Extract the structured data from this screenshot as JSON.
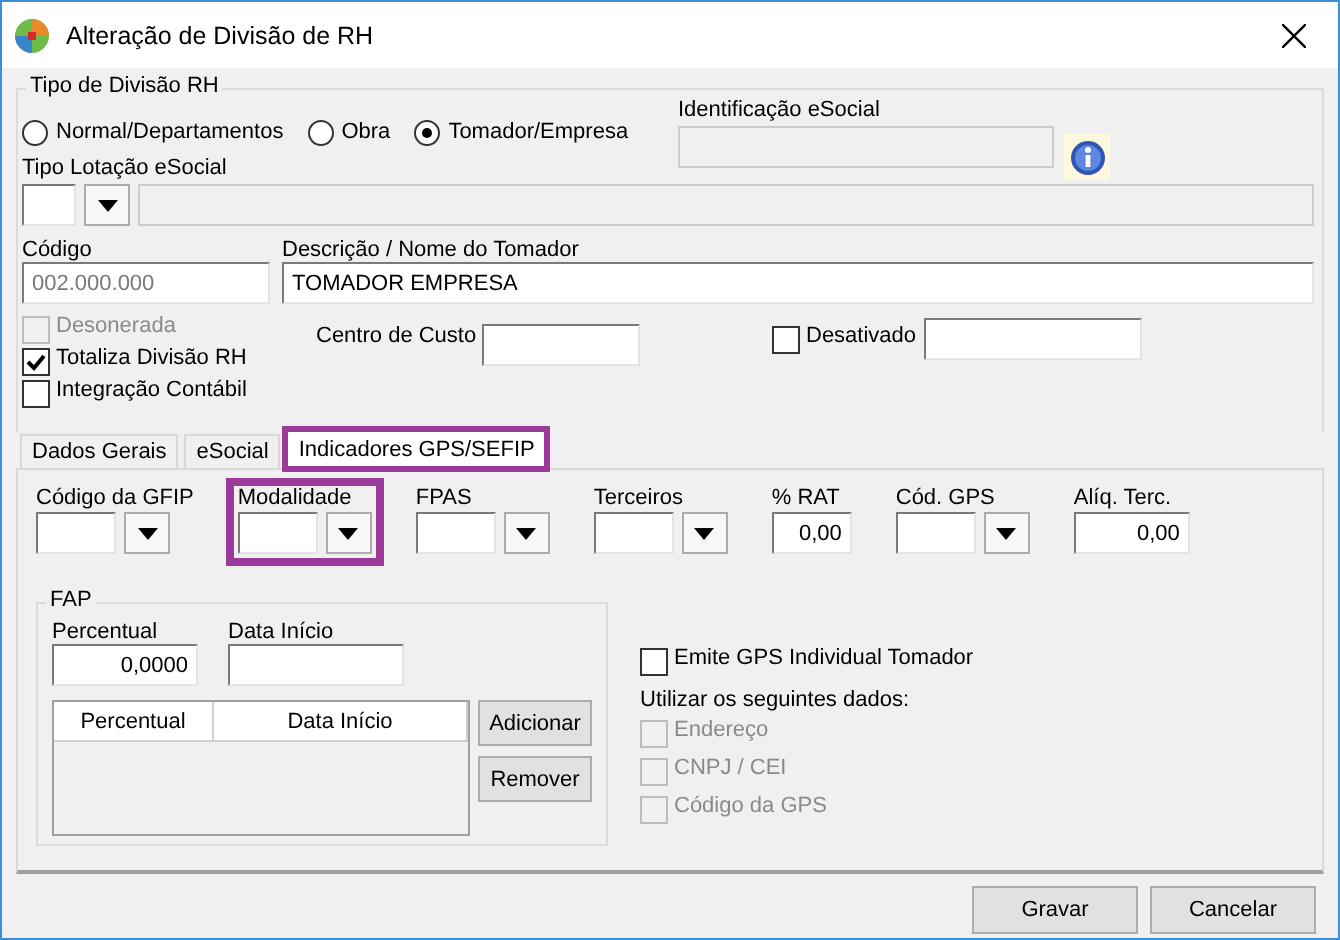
{
  "window": {
    "title": "Alteração de Divisão de RH"
  },
  "tipo_divisao": {
    "legend": "Tipo de Divisão RH",
    "options": [
      {
        "label": "Normal/Departamentos",
        "selected": false
      },
      {
        "label": "Obra",
        "selected": false
      },
      {
        "label": "Tomador/Empresa",
        "selected": true
      }
    ]
  },
  "identificacao": {
    "label": "Identificação eSocial"
  },
  "tipo_lotacao": {
    "label": "Tipo Lotação eSocial"
  },
  "codigo": {
    "label": "Código",
    "value": "002.000.000",
    "disabled": true
  },
  "descricao": {
    "label": "Descrição / Nome do Tomador",
    "value": "TOMADOR EMPRESA"
  },
  "checks": [
    {
      "label": "Desonerada",
      "checked": false,
      "disabled": true
    },
    {
      "label": "Totaliza Divisão RH",
      "checked": true,
      "disabled": false
    },
    {
      "label": "Integração Contábil",
      "checked": false,
      "disabled": false
    }
  ],
  "centro_custo": {
    "label": "Centro de Custo"
  },
  "desativado": {
    "label": "Desativado",
    "checked": false
  },
  "tabs": [
    {
      "label": "Dados Gerais",
      "selected": false,
      "highlighted": false
    },
    {
      "label": "eSocial",
      "selected": false,
      "highlighted": false
    },
    {
      "label": "Indicadores GPS/SEFIP",
      "selected": true,
      "highlighted": true
    }
  ],
  "indicators": [
    {
      "kind": "combo",
      "label": "Código da GFIP",
      "highlighted": false
    },
    {
      "kind": "combo",
      "label": "Modalidade",
      "highlighted": true
    },
    {
      "kind": "combo",
      "label": "FPAS",
      "highlighted": false
    },
    {
      "kind": "combo",
      "label": "Terceiros",
      "highlighted": false
    },
    {
      "kind": "text",
      "label": "% RAT",
      "value": "0,00",
      "highlighted": false
    },
    {
      "kind": "combo",
      "label": "Cód. GPS",
      "highlighted": false
    },
    {
      "kind": "text",
      "label": "Alíq. Terc.",
      "value": "0,00",
      "highlighted": false
    }
  ],
  "fap": {
    "legend": "FAP",
    "percentual": {
      "label": "Percentual",
      "value": "0,0000"
    },
    "data_inicio": {
      "label": "Data Início"
    },
    "columns": [
      "Percentual",
      "Data Início"
    ],
    "buttons": [
      "Adicionar",
      "Remover"
    ]
  },
  "emite": {
    "label": "Emite GPS Individual Tomador",
    "checked": false
  },
  "utilizar": {
    "label": "Utilizar os seguintes dados:",
    "options": [
      {
        "label": "Endereço",
        "checked": false,
        "disabled": true
      },
      {
        "label": "CNPJ / CEI",
        "checked": false,
        "disabled": true
      },
      {
        "label": "Código da GPS",
        "checked": false,
        "disabled": true
      }
    ]
  },
  "buttons": [
    "Gravar",
    "Cancelar"
  ]
}
